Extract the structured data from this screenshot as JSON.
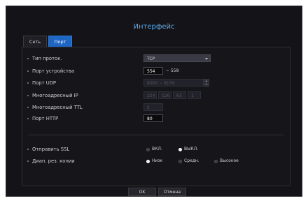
{
  "dialog": {
    "title": "Интерфейс"
  },
  "tabs": [
    {
      "label": "Сеть",
      "active": false
    },
    {
      "label": "Порт",
      "active": true
    }
  ],
  "fields": {
    "protocol": {
      "label": "Тип проток.",
      "value": "TCP"
    },
    "device_port": {
      "label": "Порт устройства",
      "value": "554",
      "range_end": "~ 558"
    },
    "udp_port": {
      "label": "Порт UDP",
      "value": "8000 ~ 8159"
    },
    "multicast_ip": {
      "label": "Многоадресный IP",
      "octets": [
        "224",
        "126",
        "63",
        "1"
      ]
    },
    "multicast_ttl": {
      "label": "Многоадресный TTL",
      "value": "5"
    },
    "http_port": {
      "label": "Порт HTTP",
      "value": "80"
    }
  },
  "ssl": {
    "label": "Отправить SSL",
    "options": [
      {
        "label": "ВКЛ.",
        "selected": false
      },
      {
        "label": "ВЫКЛ.",
        "selected": true
      }
    ]
  },
  "backup": {
    "label": "Диап. рез. копии",
    "options": [
      {
        "label": "Низк",
        "selected": true
      },
      {
        "label": "Средн.",
        "selected": false
      },
      {
        "label": "Высокое",
        "selected": false
      }
    ]
  },
  "buttons": {
    "ok": "OK",
    "cancel": "Отмена"
  },
  "colors": {
    "accent": "#1e66c4",
    "title": "#5aa8e8",
    "background": "#141418"
  }
}
